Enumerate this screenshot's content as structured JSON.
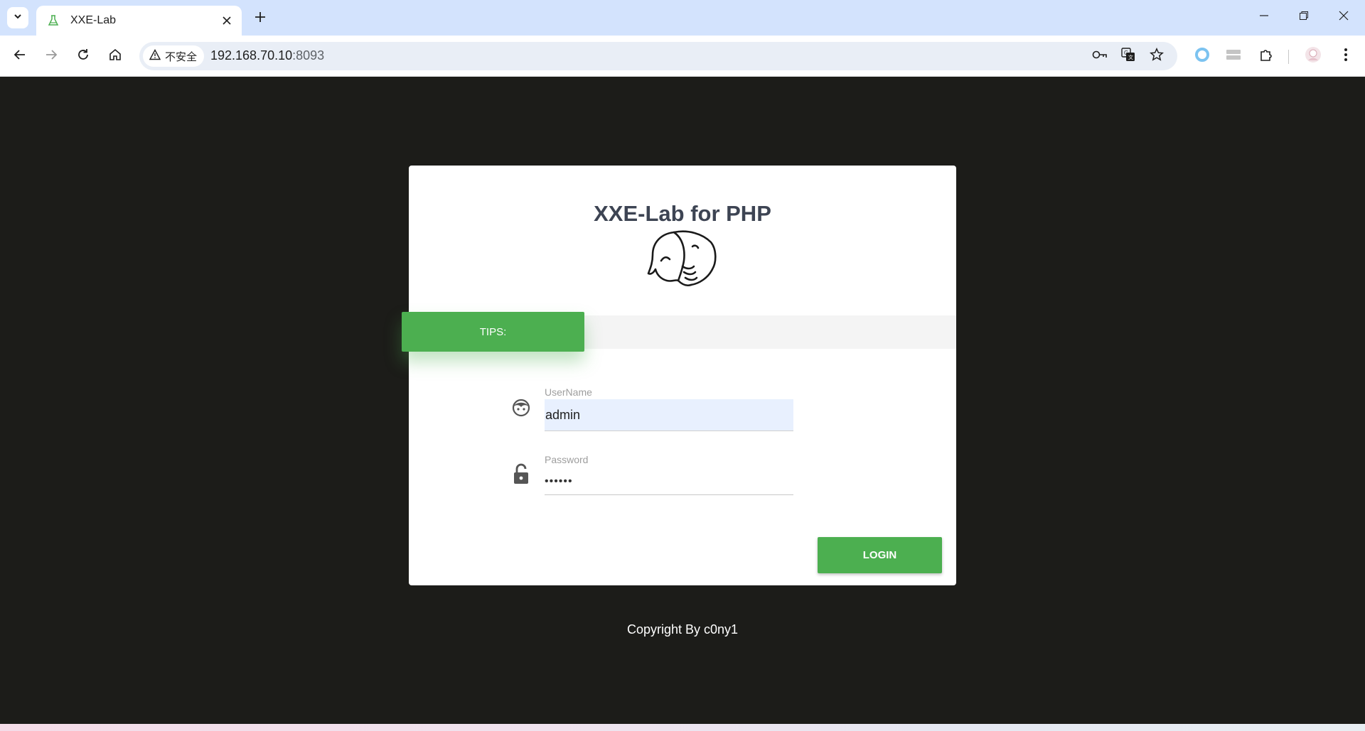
{
  "browser": {
    "tab_title": "XXE-Lab",
    "security_label": "不安全",
    "url_host": "192.168.70.10",
    "url_port": ":8093"
  },
  "page": {
    "title": "XXE-Lab for PHP",
    "tips_label": "TIPS:",
    "username_label": "UserName",
    "username_value": "admin",
    "password_label": "Password",
    "password_value": "••••••",
    "login_label": "LOGIN",
    "copyright": "Copyright By c0ny1"
  },
  "colors": {
    "accent": "#4caf50",
    "background": "#1c1c19",
    "tabstrip": "#d3e3fd",
    "title": "#3d4453"
  },
  "icons": {
    "tab_favicon": "flask-icon",
    "user_field": "face-icon",
    "password_field": "lock-open-icon",
    "logo": "elephant-logo"
  }
}
